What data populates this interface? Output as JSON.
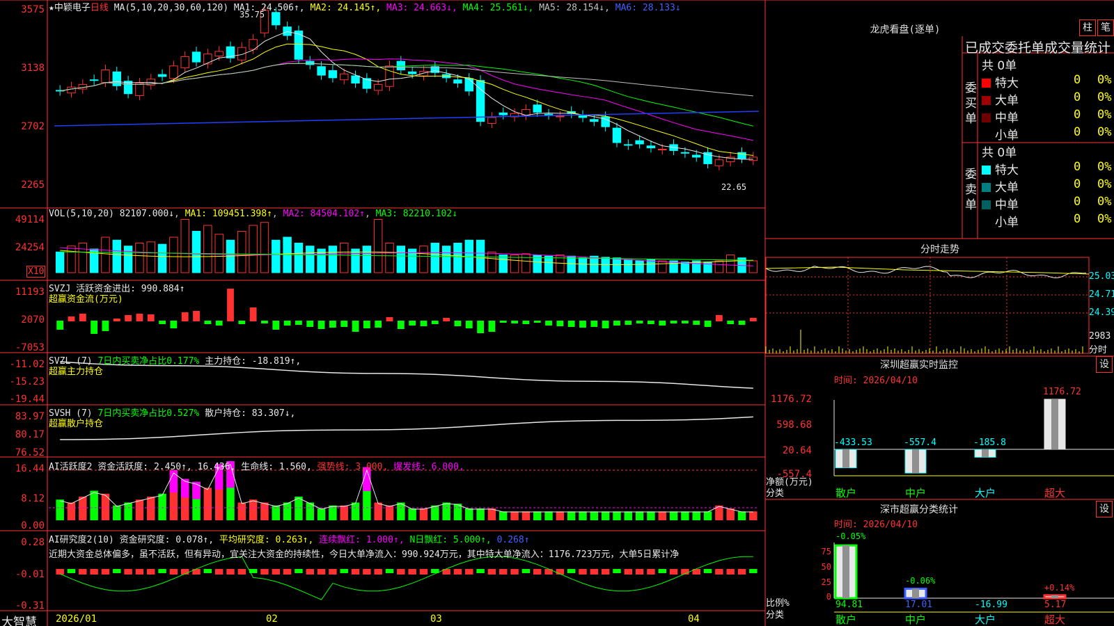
{
  "stock": {
    "star": "★",
    "name": "中颖电子",
    "period": "日线",
    "ma_params": "MA(5,10,20,30,60,120)"
  },
  "ma_values": [
    {
      "label": "MA1: 24.506↑",
      "color": "#e8e8e8"
    },
    {
      "label": "MA2: 24.145↑",
      "color": "#ffff00"
    },
    {
      "label": "MA3: 24.663↓",
      "color": "#ff00ff"
    },
    {
      "label": "MA4: 25.561↓",
      "color": "#00ff00"
    },
    {
      "label": "MA5: 28.154↓",
      "color": "#c0c0c0"
    },
    {
      "label": "MA6: 28.133↓",
      "color": "#4060ff"
    }
  ],
  "price_axis": {
    "top": "3575",
    "t1": "3138",
    "t2": "2702",
    "t3": "2265"
  },
  "price_marks": {
    "high": "35.75",
    "low": "22.65"
  },
  "vol": {
    "header": "VOL(5,10,20)",
    "value": "82107.000↓",
    "ma1": "MA1: 109451.398↑",
    "ma2": "MA2: 84504.102↑",
    "ma3": "MA3: 82210.102↓",
    "axis": {
      "a": "49114",
      "b": "24254",
      "c": "X10"
    }
  },
  "svzj": {
    "header": "SVZJ  活跃资金进出: 990.884↑",
    "sub": "超赢资金流(万元)",
    "axis": {
      "a": "11193",
      "b": "2070",
      "c": "-7053"
    }
  },
  "svzl": {
    "header1": "SVZL (7)",
    "header2": "7日内买卖净占比0.177%",
    "header3": "主力持仓: -18.819↑,",
    "sub": "超赢主力持仓",
    "axis": {
      "a": "-11.02",
      "b": "-15.23",
      "c": "-19.44"
    }
  },
  "svsh": {
    "header1": "SVSH (7)",
    "header2": "7日内买卖净占比0.527%",
    "header3": "散户持仓: 83.307↓,",
    "sub": "超赢散户持仓",
    "axis": {
      "a": "83.97",
      "b": "80.17",
      "c": "76.52"
    }
  },
  "ai1": {
    "h1": "AI活跃度2 资金活跃度: 2.450↑,",
    "h2": "16.436,",
    "h3": "生命线: 1.560,",
    "h4": "强势线: 3.000,",
    "h5": "爆发线: 6.000,",
    "axis": {
      "a": "16.44",
      "b": "8.12",
      "c": "0.00"
    }
  },
  "ai2": {
    "h1": "AI研究度2(10) 资金研究度: 0.078↑,",
    "h2": "平均研究度: 0.263↑,",
    "h3": "连续飘红: 1.000↑,",
    "h4": "N日飘红: 5.000↑,",
    "h5": "0.268↑",
    "text": "近期大资金总体偏多，虽不活跃，但有异动，宜关注大资金的持续性，今日大单净流入：990.924万元，其中特大单净流入：1176.723万元，大单5日累计净",
    "axis": {
      "a": "0.28",
      "b": "-0.01",
      "c": "-0.31"
    }
  },
  "dates": {
    "brand": "大智慧",
    "d1": "2026/01",
    "d2": "02",
    "d3": "03",
    "d4": "04"
  },
  "right": {
    "dragon_title": "龙虎看盘(逐单)",
    "btn_zhu": "柱",
    "btn_bi": "笔",
    "stat_title": "已成交委托单成交量统计",
    "buy_group": "委买单",
    "sell_group": "委卖单",
    "buy_total": "共 0单",
    "sell_total": "共 0单",
    "buy_rows": [
      {
        "name": "特大",
        "n": "0",
        "p": "0%",
        "color": "#ff0000"
      },
      {
        "name": "大单",
        "n": "0",
        "p": "0%",
        "color": "#a00000"
      },
      {
        "name": "中单",
        "n": "0",
        "p": "0%",
        "color": "#700000"
      },
      {
        "name": "小单",
        "n": "0",
        "p": "0%",
        "color": "#000000"
      }
    ],
    "sell_rows": [
      {
        "name": "特大",
        "n": "0",
        "p": "0%",
        "color": "#00ffff"
      },
      {
        "name": "大单",
        "n": "0",
        "p": "0%",
        "color": "#008080"
      },
      {
        "name": "中单",
        "n": "0",
        "p": "0%",
        "color": "#006060"
      },
      {
        "name": "小单",
        "n": "0",
        "p": "0%",
        "color": "#000000"
      }
    ],
    "intraday_title": "分时走势",
    "intraday_axis": {
      "a": "25.03",
      "b": "24.71",
      "c": "24.39",
      "d": "2983",
      "e": "分时"
    },
    "monitor_title": "深圳超赢实时监控",
    "btn_set": "设",
    "monitor_time": "时间: 2026/04/10",
    "monitor_axis": {
      "a": "1176.72",
      "b": "598.68",
      "c": "20.64",
      "d": "-557.4"
    },
    "monitor_labels": {
      "net": "净额(万元)",
      "cls": "分类"
    },
    "monitor_vals": [
      "-433.53",
      "-557.4",
      "-185.8",
      "1176.72"
    ],
    "cats": [
      "散户",
      "中户",
      "大户",
      "超大"
    ],
    "class_title": "深市超赢分类统计",
    "class_time": "时间: 2026/04/10",
    "class_axis": {
      "a": "75",
      "b": "50",
      "c": "25",
      "d": "0"
    },
    "class_labels": {
      "ratio": "比例%",
      "cls": "分类"
    },
    "class_top": [
      "-0.05%",
      "-0.06%",
      "",
      "+0.14%"
    ],
    "class_vals": [
      "94.81",
      "17.01",
      "-16.99",
      "5.17"
    ]
  },
  "chart_data": [
    {
      "type": "candlestick",
      "title": "中颖电子 日线",
      "x": [
        "2026/01",
        "02",
        "03",
        "04"
      ],
      "ohlc_note": "daily candles",
      "close": [
        29.6,
        29.9,
        30.1,
        30.4,
        31.2,
        30.0,
        29.4,
        30.2,
        30.5,
        30.7,
        31.5,
        32.2,
        31.8,
        32.4,
        32.6,
        32.1,
        32.9,
        33.5,
        35.7,
        34.6,
        33.8,
        32.0,
        31.6,
        30.8,
        30.6,
        30.9,
        30.2,
        29.8,
        30.1,
        31.5,
        31.2,
        30.9,
        31.1,
        31.0,
        30.6,
        30.2,
        29.6,
        27.3,
        27.6,
        27.8,
        27.9,
        28.2,
        28.0,
        27.8,
        27.7,
        27.9,
        27.6,
        27.3,
        26.9,
        25.7,
        25.5,
        25.6,
        25.3,
        25.2,
        25.1,
        24.9,
        24.6,
        24.1,
        24.4,
        24.6,
        24.5,
        24.6
      ],
      "high": "35.75",
      "low": "22.65"
    },
    {
      "type": "bar",
      "title": "VOL(5,10,20)",
      "ylim": [
        0,
        49114
      ]
    },
    {
      "type": "bar",
      "title": "SVZJ 活跃资金进出",
      "ylim": [
        -7053,
        11193
      ]
    }
  ]
}
